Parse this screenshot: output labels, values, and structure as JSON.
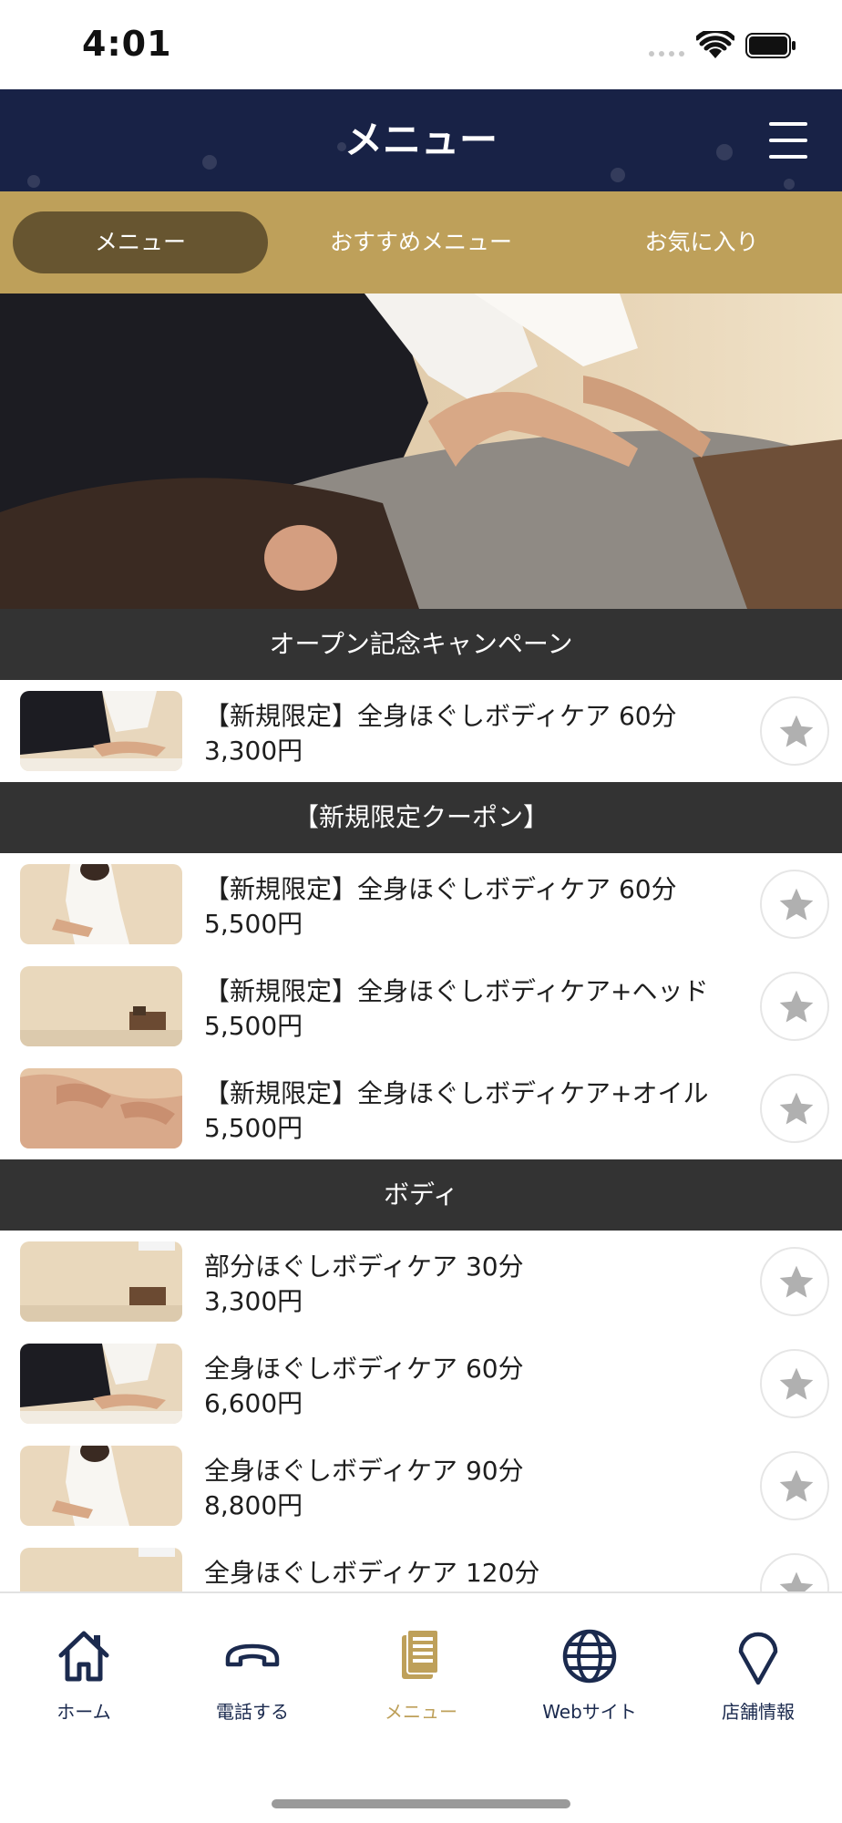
{
  "status_bar": {
    "time": "4:01"
  },
  "header": {
    "title": "メニュー"
  },
  "tabs": [
    {
      "label": "メニュー",
      "active": true
    },
    {
      "label": "おすすめメニュー",
      "active": false
    },
    {
      "label": "お気に入り",
      "active": false
    }
  ],
  "sections": [
    {
      "title": "オープン記念キャンペーン",
      "items": [
        {
          "name": "【新規限定】全身ほぐしボディケア 60分",
          "price": "3,300円"
        }
      ]
    },
    {
      "title": "【新規限定クーポン】",
      "items": [
        {
          "name": "【新規限定】全身ほぐしボディケア 60分",
          "price": "5,500円"
        },
        {
          "name": "【新規限定】全身ほぐしボディケア+ヘッド",
          "price": "5,500円"
        },
        {
          "name": "【新規限定】全身ほぐしボディケア+オイル",
          "price": "5,500円"
        }
      ]
    },
    {
      "title": "ボディ",
      "items": [
        {
          "name": "部分ほぐしボディケア 30分",
          "price": "3,300円"
        },
        {
          "name": "全身ほぐしボディケア 60分",
          "price": "6,600円"
        },
        {
          "name": "全身ほぐしボディケア 90分",
          "price": "8,800円"
        },
        {
          "name": "全身ほぐしボディケア 120分",
          "price": ""
        }
      ]
    }
  ],
  "bottom_nav": [
    {
      "label": "ホーム",
      "icon": "home-icon"
    },
    {
      "label": "電話する",
      "icon": "phone-icon"
    },
    {
      "label": "メニュー",
      "icon": "menu-book-icon",
      "active": true
    },
    {
      "label": "Webサイト",
      "icon": "globe-icon"
    },
    {
      "label": "店舗情報",
      "icon": "map-pin-icon"
    }
  ],
  "colors": {
    "header_navy": "#182246",
    "tab_gold": "#bea05a",
    "tab_active": "#675530",
    "section_dark": "#333333",
    "nav_label_navy": "#1b2a4e",
    "star_gray": "#b0b0b0"
  }
}
